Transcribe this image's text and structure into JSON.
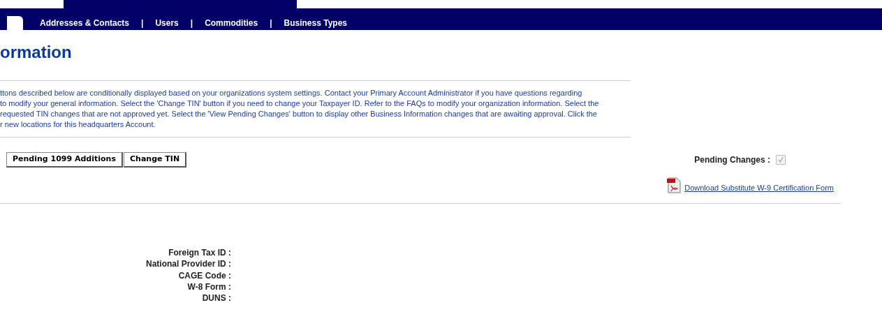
{
  "nav": {
    "items": [
      "Addresses & Contacts",
      "Users",
      "Commodities",
      "Business Types"
    ],
    "separator": "|"
  },
  "title": "ormation",
  "description": [
    "ttons described below are conditionally displayed based on your organizations system settings. Contact your Primary Account Administrator if you have questions regarding",
    "to modify your general information. Select the 'Change TIN' button if you need to change your Taxpayer ID. Refer to the FAQs to modify your organization information. Select the",
    "requested TIN changes that are not approved yet. Select the 'View Pending Changes' button to display other Business Information changes that are awaiting approval. Click the",
    "r new locations for this headquarters Account."
  ],
  "buttons": [
    "Pending 1099 Additions",
    "Change TIN"
  ],
  "pending_changes": {
    "label": "Pending Changes :",
    "checked": true,
    "disabled": true
  },
  "download_link": "Download Substitute W-9 Certification Form",
  "fields": [
    "Foreign Tax ID :",
    "National Provider ID :",
    "CAGE Code :",
    "W-8 Form :",
    "DUNS :"
  ]
}
